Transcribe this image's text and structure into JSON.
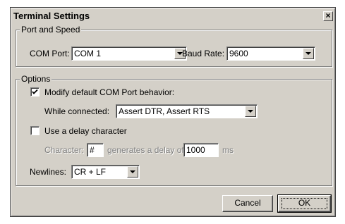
{
  "dialog": {
    "title": "Terminal Settings",
    "close_label": "×"
  },
  "port_speed": {
    "legend": "Port and Speed",
    "com_port_label": "COM Port:",
    "com_port_value": "COM 1",
    "baud_rate_label": "Baud Rate:",
    "baud_rate_value": "9600"
  },
  "options": {
    "legend": "Options",
    "modify_label": "Modify default COM Port behavior:",
    "modify_checked": true,
    "while_connected_label": "While connected:",
    "while_connected_value": "Assert DTR, Assert RTS",
    "delay_label": "Use a delay character",
    "delay_checked": false,
    "character_label": "Character:",
    "character_value": "#",
    "generates_label": "generates a delay of",
    "delay_value": "1000",
    "ms_label": "ms",
    "newlines_label": "Newlines:",
    "newlines_value": "CR + LF"
  },
  "buttons": {
    "cancel": "Cancel",
    "ok": "OK"
  }
}
